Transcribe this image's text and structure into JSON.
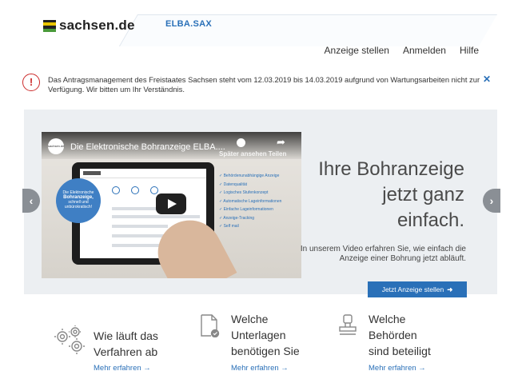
{
  "header": {
    "logo_text": "sachsen.de",
    "app_name": "ELBA",
    "app_suffix": ".SAX",
    "nav": [
      "Anzeige stellen",
      "Anmelden",
      "Hilfe"
    ]
  },
  "alert": {
    "text": "Das Antragsmanagement des Freistaates Sachsen steht vom 12.03.2019 bis 14.03.2019 aufgrund von Wartungsarbeiten nicht zur Verfügung. Wir bitten um Ihr Verständnis.",
    "icon_glyph": "!",
    "close_glyph": "✕"
  },
  "hero": {
    "prev_glyph": "‹",
    "next_glyph": "›",
    "video": {
      "title": "Die Elektronische Bohranzeige ELBA....",
      "watch_later": "Später ansehen  Teilen",
      "badge_line1": "Die Elektronische",
      "badge_line2": "Bohranzeige,",
      "badge_line3": "schnell und unbürokratisch!",
      "checklist": [
        "✓ Behördenunabhängige Anzeige",
        "✓ Datenqualität",
        "✓ Logisches Stufenkonzept",
        "✓ Automatische Lageinformationen",
        "✓ Einfache Lageinformationen",
        "✓ Anzeige-Tracking",
        "✓ Self mail"
      ]
    },
    "headline_lines": [
      "Ihre Bohranzeige",
      "jetzt ganz",
      "einfach."
    ],
    "subtext": "In unserem Video erfahren Sie, wie einfach die Anzeige einer Bohrung jetzt abläuft.",
    "cta_label": "Jetzt Anzeige stellen",
    "cta_arrow": "➜"
  },
  "info_columns": [
    {
      "icon": "gears-icon",
      "title_lines": [
        "Wie läuft das",
        "Verfahren ab"
      ],
      "link": "Mehr erfahren →"
    },
    {
      "icon": "document-check-icon",
      "title_lines": [
        "Welche",
        "Unterlagen",
        "benötigen Sie"
      ],
      "link": "Mehr erfahren →"
    },
    {
      "icon": "stamp-icon",
      "title_lines": [
        "Welche",
        "Behörden",
        "sind beteiligt"
      ],
      "link": "Mehr erfahren →"
    }
  ],
  "colors": {
    "brand_blue": "#2a70b8",
    "alert_red": "#cc2b2b",
    "hero_bg": "#eceff2"
  }
}
